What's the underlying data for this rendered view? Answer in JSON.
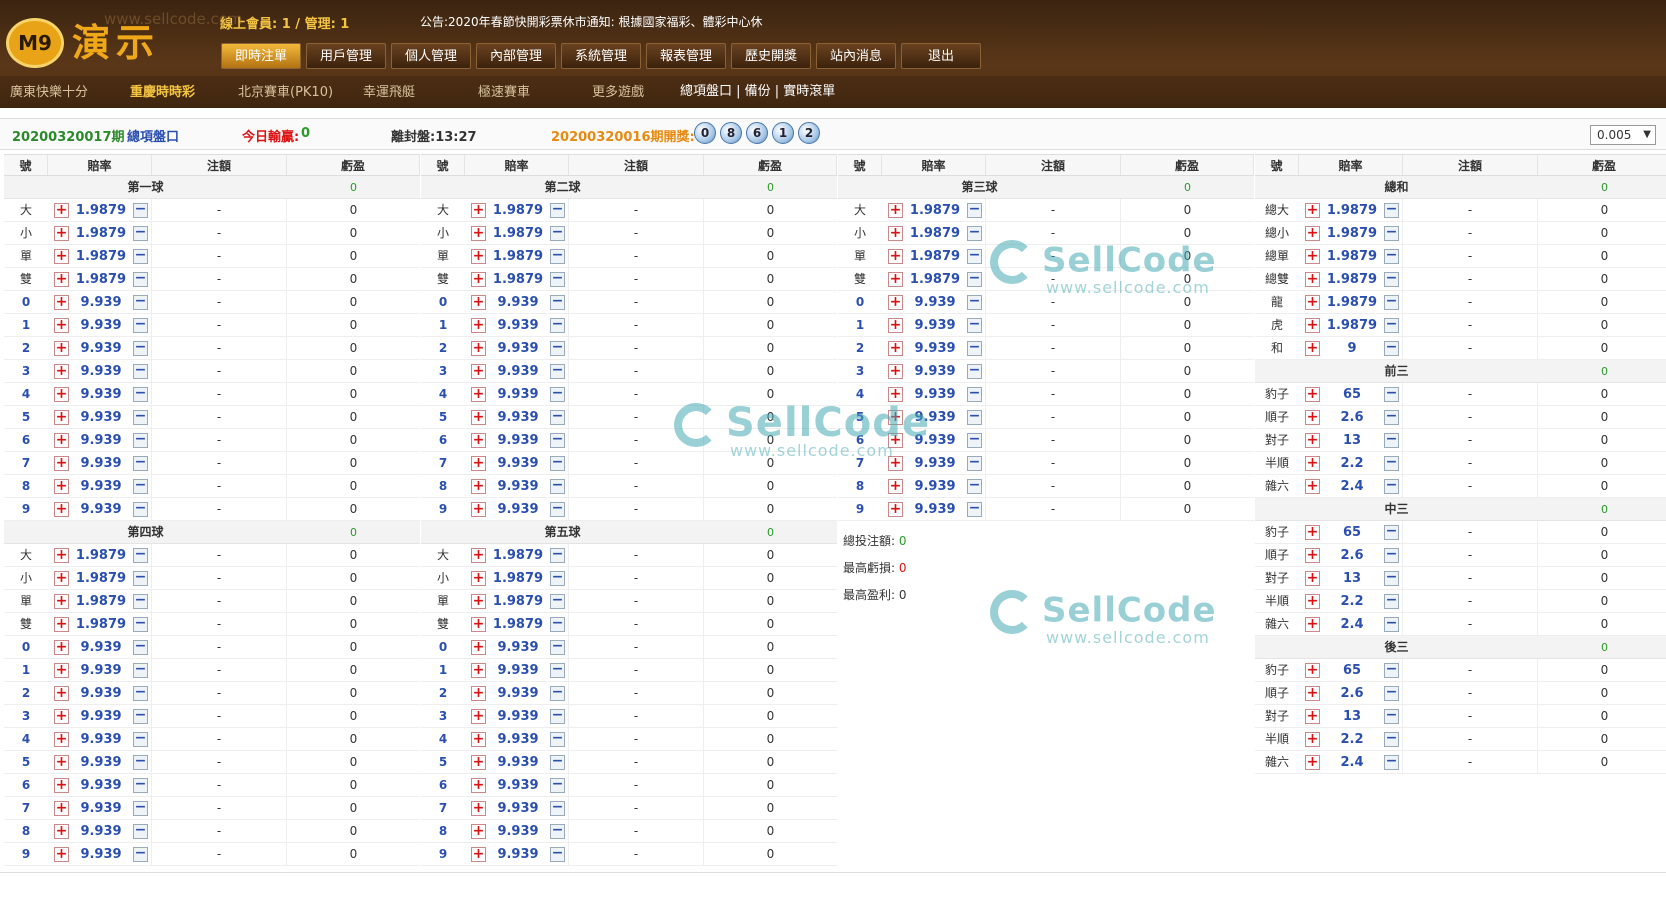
{
  "brand": {
    "logo_text": "M9",
    "title": "演示"
  },
  "header": {
    "online_text": "線上會員: 1 / 管理: 1",
    "notice": "公告:2020年春節快開彩票休市通知: 根據國家福彩、體彩中心休",
    "nav": [
      "即時注單",
      "用戶管理",
      "個人管理",
      "內部管理",
      "系統管理",
      "報表管理",
      "歷史開獎",
      "站內消息",
      "退出"
    ],
    "nav_active": 0,
    "games": [
      "廣東快樂十分",
      "重慶時時彩",
      "北京賽車(PK10)",
      "幸運飛艇",
      "極速賽車",
      "更多遊戲"
    ],
    "games_active": 1,
    "links_text": "總項盤口 | 備份 | 實時滾單"
  },
  "infobar": {
    "period": "20200320017期",
    "panel": "總項盤口",
    "today_label": "今日輸贏:",
    "today_value": "0",
    "close_text": "離封盤:13:27",
    "last_label": "20200320016期開獎:",
    "last_balls": [
      "0",
      "8",
      "6",
      "1",
      "2"
    ],
    "select_value": "0.005"
  },
  "table_headers": [
    "號",
    "賠率",
    "注額",
    "虧盈"
  ],
  "placeholder": {
    "bet": "-",
    "profit": "0"
  },
  "columns": [
    {
      "sections": [
        {
          "title": "第一球",
          "pl": "0",
          "rows": [
            [
              "大",
              "1.9879"
            ],
            [
              "小",
              "1.9879"
            ],
            [
              "單",
              "1.9879"
            ],
            [
              "雙",
              "1.9879"
            ],
            [
              "0",
              "9.939"
            ],
            [
              "1",
              "9.939"
            ],
            [
              "2",
              "9.939"
            ],
            [
              "3",
              "9.939"
            ],
            [
              "4",
              "9.939"
            ],
            [
              "5",
              "9.939"
            ],
            [
              "6",
              "9.939"
            ],
            [
              "7",
              "9.939"
            ],
            [
              "8",
              "9.939"
            ],
            [
              "9",
              "9.939"
            ]
          ]
        },
        {
          "title": "第四球",
          "pl": "0",
          "rows": [
            [
              "大",
              "1.9879"
            ],
            [
              "小",
              "1.9879"
            ],
            [
              "單",
              "1.9879"
            ],
            [
              "雙",
              "1.9879"
            ],
            [
              "0",
              "9.939"
            ],
            [
              "1",
              "9.939"
            ],
            [
              "2",
              "9.939"
            ],
            [
              "3",
              "9.939"
            ],
            [
              "4",
              "9.939"
            ],
            [
              "5",
              "9.939"
            ],
            [
              "6",
              "9.939"
            ],
            [
              "7",
              "9.939"
            ],
            [
              "8",
              "9.939"
            ],
            [
              "9",
              "9.939"
            ]
          ]
        }
      ]
    },
    {
      "sections": [
        {
          "title": "第二球",
          "pl": "0",
          "rows": [
            [
              "大",
              "1.9879"
            ],
            [
              "小",
              "1.9879"
            ],
            [
              "單",
              "1.9879"
            ],
            [
              "雙",
              "1.9879"
            ],
            [
              "0",
              "9.939"
            ],
            [
              "1",
              "9.939"
            ],
            [
              "2",
              "9.939"
            ],
            [
              "3",
              "9.939"
            ],
            [
              "4",
              "9.939"
            ],
            [
              "5",
              "9.939"
            ],
            [
              "6",
              "9.939"
            ],
            [
              "7",
              "9.939"
            ],
            [
              "8",
              "9.939"
            ],
            [
              "9",
              "9.939"
            ]
          ]
        },
        {
          "title": "第五球",
          "pl": "0",
          "rows": [
            [
              "大",
              "1.9879"
            ],
            [
              "小",
              "1.9879"
            ],
            [
              "單",
              "1.9879"
            ],
            [
              "雙",
              "1.9879"
            ],
            [
              "0",
              "9.939"
            ],
            [
              "1",
              "9.939"
            ],
            [
              "2",
              "9.939"
            ],
            [
              "3",
              "9.939"
            ],
            [
              "4",
              "9.939"
            ],
            [
              "5",
              "9.939"
            ],
            [
              "6",
              "9.939"
            ],
            [
              "7",
              "9.939"
            ],
            [
              "8",
              "9.939"
            ],
            [
              "9",
              "9.939"
            ]
          ]
        }
      ]
    },
    {
      "sections": [
        {
          "title": "第三球",
          "pl": "0",
          "rows": [
            [
              "大",
              "1.9879"
            ],
            [
              "小",
              "1.9879"
            ],
            [
              "單",
              "1.9879"
            ],
            [
              "雙",
              "1.9879"
            ],
            [
              "0",
              "9.939"
            ],
            [
              "1",
              "9.939"
            ],
            [
              "2",
              "9.939"
            ],
            [
              "3",
              "9.939"
            ],
            [
              "4",
              "9.939"
            ],
            [
              "5",
              "9.939"
            ],
            [
              "6",
              "9.939"
            ],
            [
              "7",
              "9.939"
            ],
            [
              "8",
              "9.939"
            ],
            [
              "9",
              "9.939"
            ]
          ]
        }
      ]
    },
    {
      "sections": [
        {
          "title": "總和",
          "pl": "0",
          "rows": [
            [
              "總大",
              "1.9879"
            ],
            [
              "總小",
              "1.9879"
            ],
            [
              "總單",
              "1.9879"
            ],
            [
              "總雙",
              "1.9879"
            ],
            [
              "龍",
              "1.9879"
            ],
            [
              "虎",
              "1.9879"
            ],
            [
              "和",
              "9"
            ]
          ]
        },
        {
          "title": "前三",
          "pl": "0",
          "rows": [
            [
              "豹子",
              "65"
            ],
            [
              "順子",
              "2.6"
            ],
            [
              "對子",
              "13"
            ],
            [
              "半順",
              "2.2"
            ],
            [
              "雜六",
              "2.4"
            ]
          ]
        },
        {
          "title": "中三",
          "pl": "0",
          "rows": [
            [
              "豹子",
              "65"
            ],
            [
              "順子",
              "2.6"
            ],
            [
              "對子",
              "13"
            ],
            [
              "半順",
              "2.2"
            ],
            [
              "雜六",
              "2.4"
            ]
          ]
        },
        {
          "title": "後三",
          "pl": "0",
          "rows": [
            [
              "豹子",
              "65"
            ],
            [
              "順子",
              "2.6"
            ],
            [
              "對子",
              "13"
            ],
            [
              "半順",
              "2.2"
            ],
            [
              "雜六",
              "2.4"
            ]
          ]
        }
      ]
    }
  ],
  "summary": {
    "total_label": "總投注額:",
    "total_value": "0",
    "loss_label": "最高虧損:",
    "loss_value": "0",
    "profit_label": "最高盈利:",
    "profit_value": "0"
  },
  "watermark": {
    "brand": "SellCode",
    "url": "www.sellcode.com"
  },
  "colors": {
    "accent": "#f5c542",
    "odds": "#2a4fb0",
    "positive": "#2a9a2a",
    "negative": "#d11111"
  }
}
